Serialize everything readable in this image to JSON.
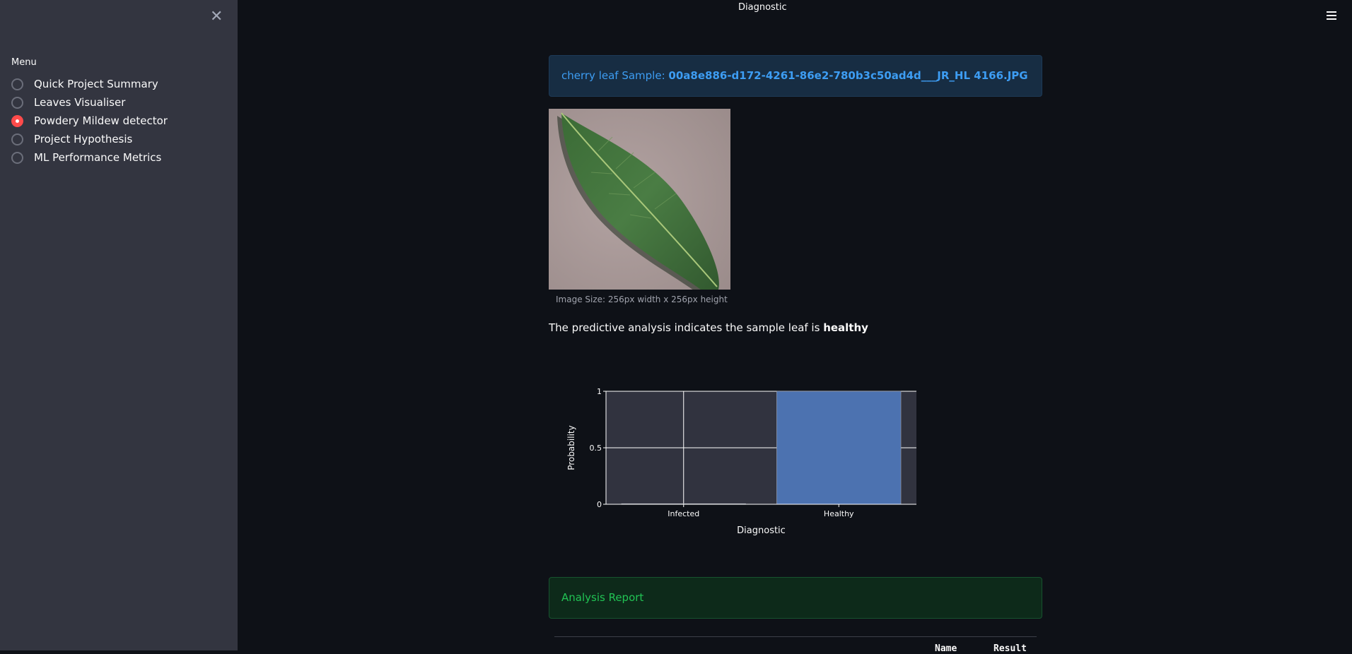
{
  "sidebar": {
    "close_label": "✕",
    "menu_label": "Menu",
    "items": [
      {
        "label": "Quick Project Summary",
        "selected": false
      },
      {
        "label": "Leaves Visualiser",
        "selected": false
      },
      {
        "label": "Powdery Mildew detector",
        "selected": true
      },
      {
        "label": "Project Hypothesis",
        "selected": false
      },
      {
        "label": "ML Performance Metrics",
        "selected": false
      }
    ],
    "accent_color": "#ff4b4b"
  },
  "header": {
    "title": "Diagnostic"
  },
  "main": {
    "info": {
      "prefix": "cherry leaf Sample: ",
      "filename": "00a8e886-d172-4261-86e2-780b3c50ad4d___JR_HL 4166.JPG"
    },
    "image_caption": "Image Size: 256px width x 256px height",
    "prediction": {
      "text": "The predictive analysis indicates the sample leaf is ",
      "result": "healthy"
    },
    "report_title": "Analysis Report",
    "table_headers": [
      "Name",
      "Result"
    ]
  },
  "chart_data": {
    "type": "bar",
    "categories": [
      "Infected",
      "Healthy"
    ],
    "values": [
      0.0,
      1.0
    ],
    "xlabel": "Diagnostic",
    "ylabel": "Probability",
    "ylim": [
      0,
      1
    ],
    "yticks": [
      "0",
      "0.5",
      "1"
    ],
    "grid": true,
    "bar_color": "#4c72b0",
    "plot_bg": "#31333f"
  }
}
